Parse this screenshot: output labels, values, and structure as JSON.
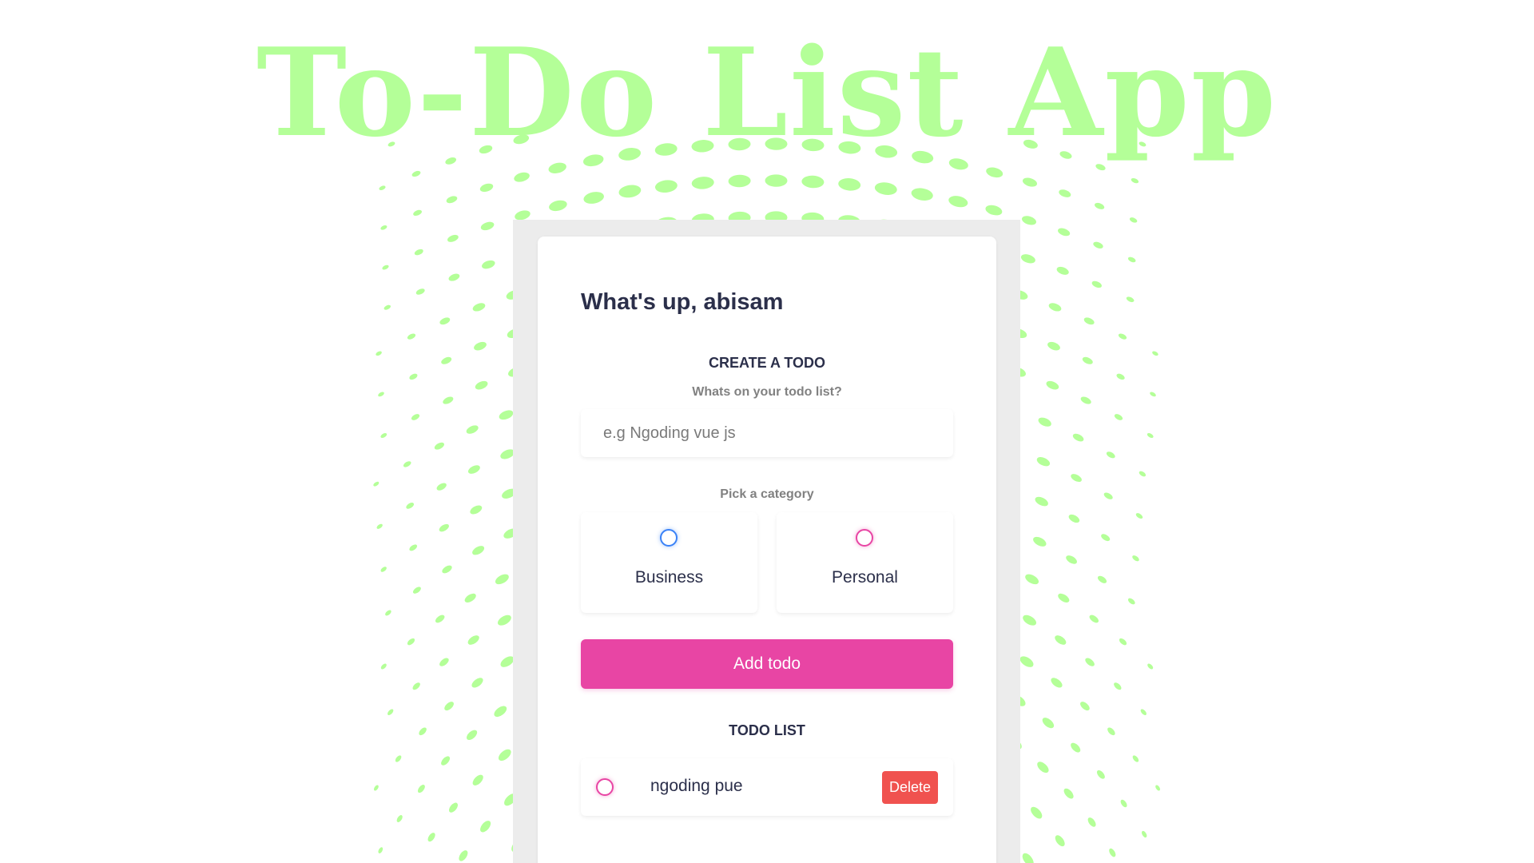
{
  "app": {
    "title": "To-Do List App"
  },
  "colors": {
    "accent_green": "#b4ff98",
    "business": "#3a82f7",
    "personal": "#e845a4",
    "add_button": "#e845a4",
    "delete_button": "#f0524f",
    "text_dark": "#2b2f4a"
  },
  "greeting": "What's up, abisam",
  "create": {
    "heading": "CREATE A TODO",
    "prompt": "Whats on your todo list?",
    "input_value": "",
    "input_placeholder": "e.g Ngoding vue js",
    "category_prompt": "Pick a category",
    "categories": [
      {
        "label": "Business",
        "selected": false
      },
      {
        "label": "Personal",
        "selected": false
      }
    ],
    "add_label": "Add todo"
  },
  "list": {
    "heading": "TODO LIST",
    "items": [
      {
        "text": "ngoding pue",
        "category": "Personal",
        "done": false,
        "delete_label": "Delete"
      }
    ]
  }
}
